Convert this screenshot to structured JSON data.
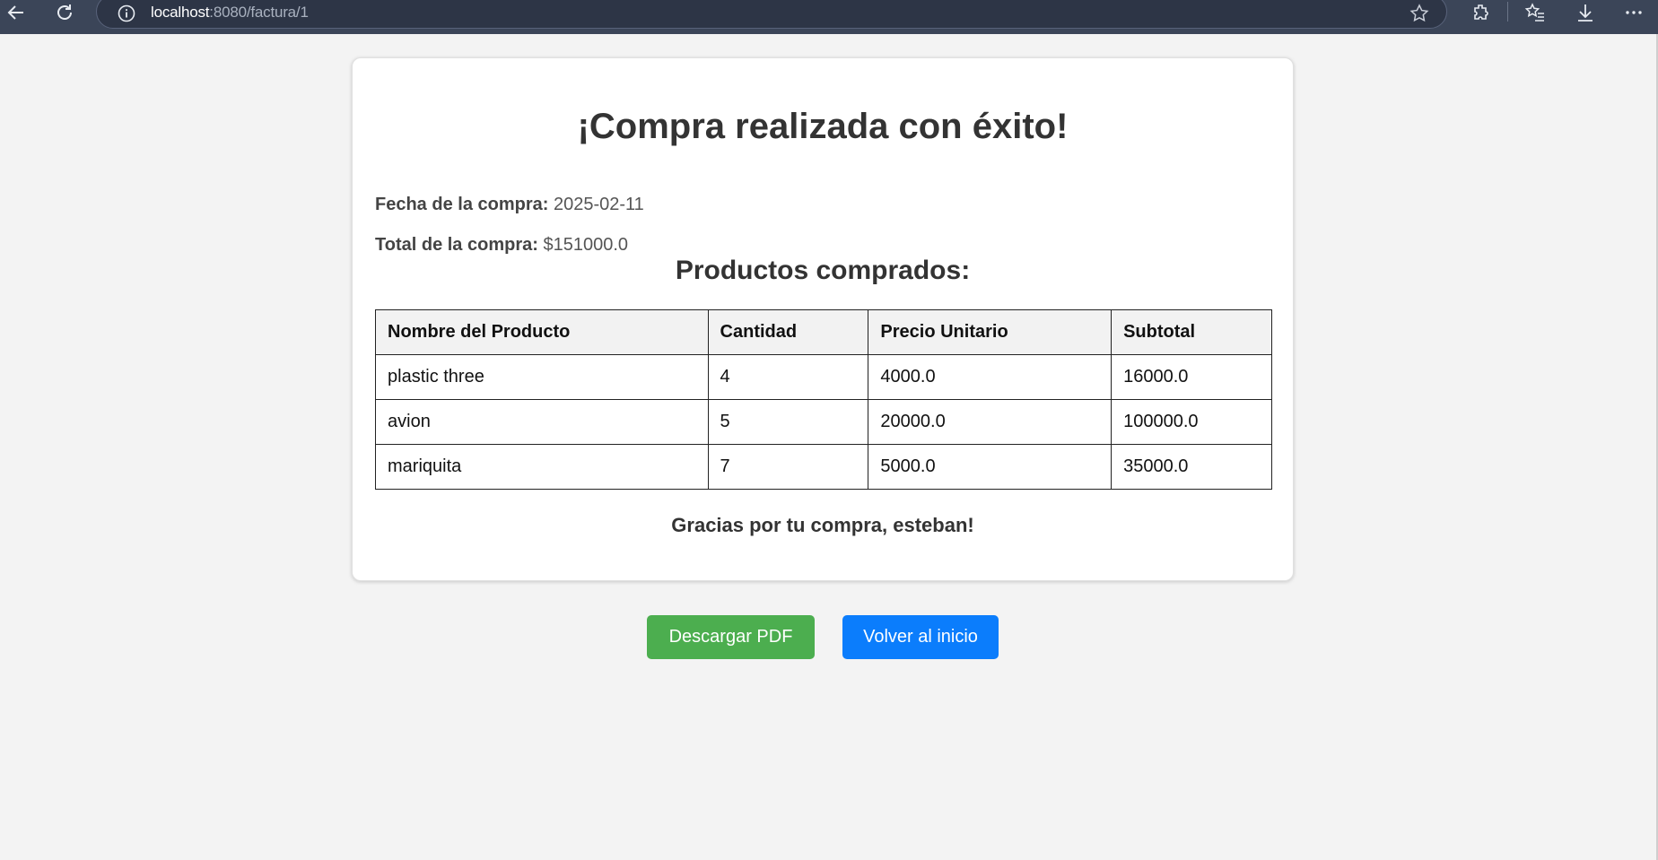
{
  "browser": {
    "url_host": "localhost",
    "url_rest": ":8080/factura/1"
  },
  "invoice": {
    "title": "¡Compra realizada con éxito!",
    "date_label": "Fecha de la compra:",
    "date_value": "2025-02-11",
    "total_label": "Total de la compra:",
    "total_value": "$151000.0",
    "products_heading": "Productos comprados:",
    "columns": [
      "Nombre del Producto",
      "Cantidad",
      "Precio Unitario",
      "Subtotal"
    ],
    "rows": [
      [
        "plastic three",
        "4",
        "4000.0",
        "16000.0"
      ],
      [
        "avion",
        "5",
        "20000.0",
        "100000.0"
      ],
      [
        "mariquita",
        "7",
        "5000.0",
        "35000.0"
      ]
    ],
    "thanks": "Gracias por tu compra, esteban!"
  },
  "actions": {
    "download_pdf": "Descargar PDF",
    "back_home": "Volver al inicio"
  },
  "colors": {
    "download_button": "#4cae4f",
    "home_button": "#0b7dfc",
    "chrome_bg": "#3b4558"
  }
}
